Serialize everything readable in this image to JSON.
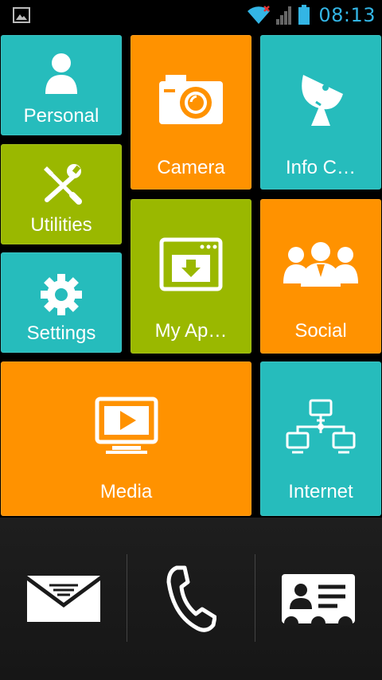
{
  "status_bar": {
    "time": "08:13",
    "clock_color": "#33b5e5",
    "icons": [
      "image-notification-icon",
      "wifi-icon",
      "signal-icon",
      "battery-icon"
    ]
  },
  "colors": {
    "teal": "#26bcbc",
    "orange": "#ff9200",
    "green": "#9ab800",
    "dock": "#1a1a1a"
  },
  "tiles": {
    "personal": {
      "label": "Personal",
      "icon": "person-icon"
    },
    "camera": {
      "label": "Camera",
      "icon": "camera-icon"
    },
    "info": {
      "label": "Info C…",
      "icon": "satellite-dish-icon"
    },
    "utilities": {
      "label": "Utilities",
      "icon": "tools-icon"
    },
    "myapps": {
      "label": "My Ap…",
      "icon": "download-window-icon"
    },
    "social": {
      "label": "Social",
      "icon": "people-group-icon"
    },
    "settings": {
      "label": "Settings",
      "icon": "gear-icon"
    },
    "media": {
      "label": "Media",
      "icon": "play-monitor-icon"
    },
    "internet": {
      "label": "Internet",
      "icon": "network-icon"
    }
  },
  "dock": {
    "items": [
      {
        "name": "messages",
        "icon": "envelope-icon"
      },
      {
        "name": "phone",
        "icon": "phone-icon"
      },
      {
        "name": "contacts",
        "icon": "contact-card-icon"
      }
    ]
  }
}
